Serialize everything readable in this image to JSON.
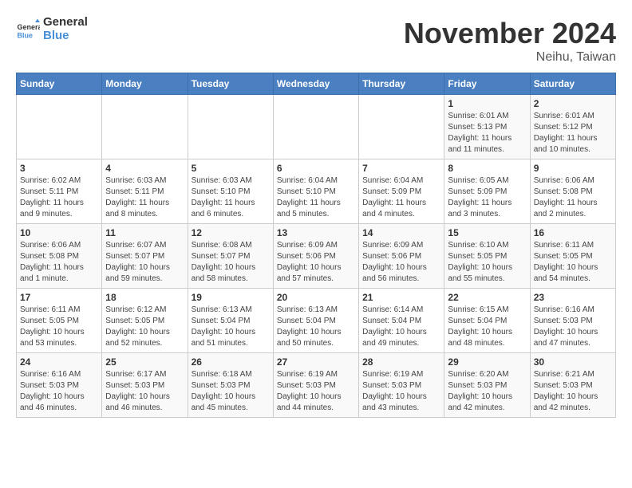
{
  "logo": {
    "line1": "General",
    "line2": "Blue"
  },
  "title": "November 2024",
  "subtitle": "Neihu, Taiwan",
  "weekdays": [
    "Sunday",
    "Monday",
    "Tuesday",
    "Wednesday",
    "Thursday",
    "Friday",
    "Saturday"
  ],
  "weeks": [
    [
      {
        "day": "",
        "info": ""
      },
      {
        "day": "",
        "info": ""
      },
      {
        "day": "",
        "info": ""
      },
      {
        "day": "",
        "info": ""
      },
      {
        "day": "",
        "info": ""
      },
      {
        "day": "1",
        "info": "Sunrise: 6:01 AM\nSunset: 5:13 PM\nDaylight: 11 hours and 11 minutes."
      },
      {
        "day": "2",
        "info": "Sunrise: 6:01 AM\nSunset: 5:12 PM\nDaylight: 11 hours and 10 minutes."
      }
    ],
    [
      {
        "day": "3",
        "info": "Sunrise: 6:02 AM\nSunset: 5:11 PM\nDaylight: 11 hours and 9 minutes."
      },
      {
        "day": "4",
        "info": "Sunrise: 6:03 AM\nSunset: 5:11 PM\nDaylight: 11 hours and 8 minutes."
      },
      {
        "day": "5",
        "info": "Sunrise: 6:03 AM\nSunset: 5:10 PM\nDaylight: 11 hours and 6 minutes."
      },
      {
        "day": "6",
        "info": "Sunrise: 6:04 AM\nSunset: 5:10 PM\nDaylight: 11 hours and 5 minutes."
      },
      {
        "day": "7",
        "info": "Sunrise: 6:04 AM\nSunset: 5:09 PM\nDaylight: 11 hours and 4 minutes."
      },
      {
        "day": "8",
        "info": "Sunrise: 6:05 AM\nSunset: 5:09 PM\nDaylight: 11 hours and 3 minutes."
      },
      {
        "day": "9",
        "info": "Sunrise: 6:06 AM\nSunset: 5:08 PM\nDaylight: 11 hours and 2 minutes."
      }
    ],
    [
      {
        "day": "10",
        "info": "Sunrise: 6:06 AM\nSunset: 5:08 PM\nDaylight: 11 hours and 1 minute."
      },
      {
        "day": "11",
        "info": "Sunrise: 6:07 AM\nSunset: 5:07 PM\nDaylight: 10 hours and 59 minutes."
      },
      {
        "day": "12",
        "info": "Sunrise: 6:08 AM\nSunset: 5:07 PM\nDaylight: 10 hours and 58 minutes."
      },
      {
        "day": "13",
        "info": "Sunrise: 6:09 AM\nSunset: 5:06 PM\nDaylight: 10 hours and 57 minutes."
      },
      {
        "day": "14",
        "info": "Sunrise: 6:09 AM\nSunset: 5:06 PM\nDaylight: 10 hours and 56 minutes."
      },
      {
        "day": "15",
        "info": "Sunrise: 6:10 AM\nSunset: 5:05 PM\nDaylight: 10 hours and 55 minutes."
      },
      {
        "day": "16",
        "info": "Sunrise: 6:11 AM\nSunset: 5:05 PM\nDaylight: 10 hours and 54 minutes."
      }
    ],
    [
      {
        "day": "17",
        "info": "Sunrise: 6:11 AM\nSunset: 5:05 PM\nDaylight: 10 hours and 53 minutes."
      },
      {
        "day": "18",
        "info": "Sunrise: 6:12 AM\nSunset: 5:05 PM\nDaylight: 10 hours and 52 minutes."
      },
      {
        "day": "19",
        "info": "Sunrise: 6:13 AM\nSunset: 5:04 PM\nDaylight: 10 hours and 51 minutes."
      },
      {
        "day": "20",
        "info": "Sunrise: 6:13 AM\nSunset: 5:04 PM\nDaylight: 10 hours and 50 minutes."
      },
      {
        "day": "21",
        "info": "Sunrise: 6:14 AM\nSunset: 5:04 PM\nDaylight: 10 hours and 49 minutes."
      },
      {
        "day": "22",
        "info": "Sunrise: 6:15 AM\nSunset: 5:04 PM\nDaylight: 10 hours and 48 minutes."
      },
      {
        "day": "23",
        "info": "Sunrise: 6:16 AM\nSunset: 5:03 PM\nDaylight: 10 hours and 47 minutes."
      }
    ],
    [
      {
        "day": "24",
        "info": "Sunrise: 6:16 AM\nSunset: 5:03 PM\nDaylight: 10 hours and 46 minutes."
      },
      {
        "day": "25",
        "info": "Sunrise: 6:17 AM\nSunset: 5:03 PM\nDaylight: 10 hours and 46 minutes."
      },
      {
        "day": "26",
        "info": "Sunrise: 6:18 AM\nSunset: 5:03 PM\nDaylight: 10 hours and 45 minutes."
      },
      {
        "day": "27",
        "info": "Sunrise: 6:19 AM\nSunset: 5:03 PM\nDaylight: 10 hours and 44 minutes."
      },
      {
        "day": "28",
        "info": "Sunrise: 6:19 AM\nSunset: 5:03 PM\nDaylight: 10 hours and 43 minutes."
      },
      {
        "day": "29",
        "info": "Sunrise: 6:20 AM\nSunset: 5:03 PM\nDaylight: 10 hours and 42 minutes."
      },
      {
        "day": "30",
        "info": "Sunrise: 6:21 AM\nSunset: 5:03 PM\nDaylight: 10 hours and 42 minutes."
      }
    ]
  ]
}
